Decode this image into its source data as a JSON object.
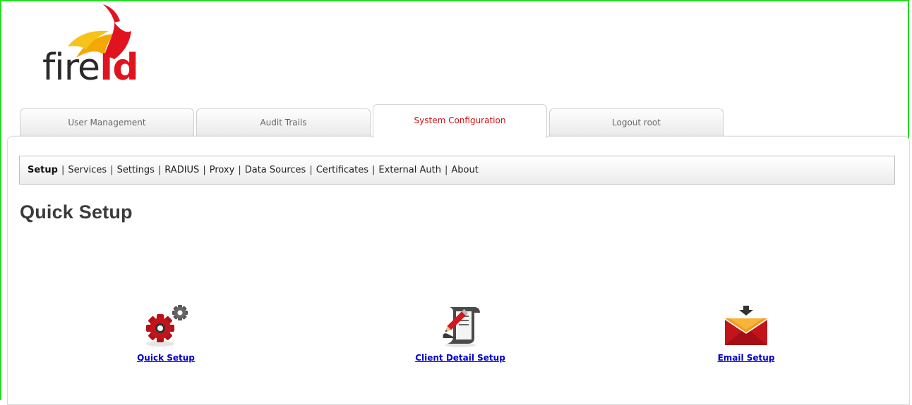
{
  "logo": {
    "part1": "fire",
    "part2": "Id"
  },
  "tabs": [
    {
      "label": "User Management",
      "active": false
    },
    {
      "label": "Audit Trails",
      "active": false
    },
    {
      "label": "System Configuration",
      "active": true
    },
    {
      "label": "Logout root",
      "active": false
    }
  ],
  "subnav": {
    "separator": "|",
    "items": [
      "Setup",
      "Services",
      "Settings",
      "RADIUS",
      "Proxy",
      "Data Sources",
      "Certificates",
      "External Auth",
      "About"
    ]
  },
  "page": {
    "title": "Quick Setup"
  },
  "setup_links": [
    {
      "label": "Quick Setup",
      "icon": "gears-icon"
    },
    {
      "label": "Client Detail Setup",
      "icon": "document-edit-icon"
    },
    {
      "label": "Email Setup",
      "icon": "envelope-download-icon"
    }
  ],
  "colors": {
    "frame": "#22dd22",
    "active_tab_text": "#d11010",
    "link": "#0000cc",
    "logo_red": "#e0141e",
    "logo_orange": "#f5a800"
  }
}
